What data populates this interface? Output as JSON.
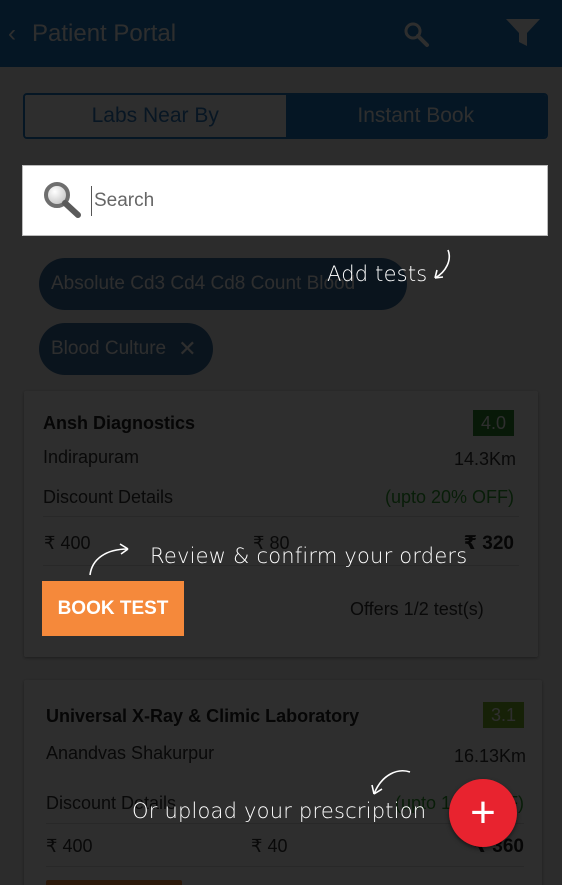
{
  "header": {
    "title": "Patient Portal"
  },
  "tabs": [
    {
      "label": "Labs Near By",
      "active": false
    },
    {
      "label": "Instant Book",
      "active": true
    }
  ],
  "search": {
    "placeholder": "Search"
  },
  "chips": [
    {
      "label": "Absolute Cd3 Cd4 Cd8 Count Blood"
    },
    {
      "label": "Blood Culture"
    }
  ],
  "labs": [
    {
      "name": "Ansh Diagnostics",
      "rating": "4.0",
      "location": "Indirapuram",
      "distance": "14.3Km",
      "discount_label": "Discount Details",
      "discount_value": "(upto 20% OFF)",
      "price": "₹ 400",
      "discount_amount": "₹ 80",
      "final_price": "₹ 320",
      "book_label": "BOOK TEST",
      "offers": "Offers 1/2 test(s)"
    },
    {
      "name": "Universal X-Ray & Climic Laboratory",
      "rating": "3.1",
      "location": "Anandvas Shakurpur",
      "distance": "16.13Km",
      "discount_label": "Discount Details",
      "discount_value": "(upto 10% OFF)",
      "price": "₹ 400",
      "discount_amount": "₹ 40",
      "final_price": "₹ 360"
    }
  ],
  "coach_marks": {
    "add_tests": "Add tests",
    "review": "Review & confirm your orders",
    "upload": "Or upload your prescription"
  },
  "fab": {
    "label": "+"
  },
  "colors": {
    "primary": "#1f7cc6",
    "accent": "#f5893b",
    "fab": "#e8232f",
    "discount": "#2f9e2f",
    "rating_high": "#2e8b2e",
    "rating_mid": "#7cb52a"
  }
}
